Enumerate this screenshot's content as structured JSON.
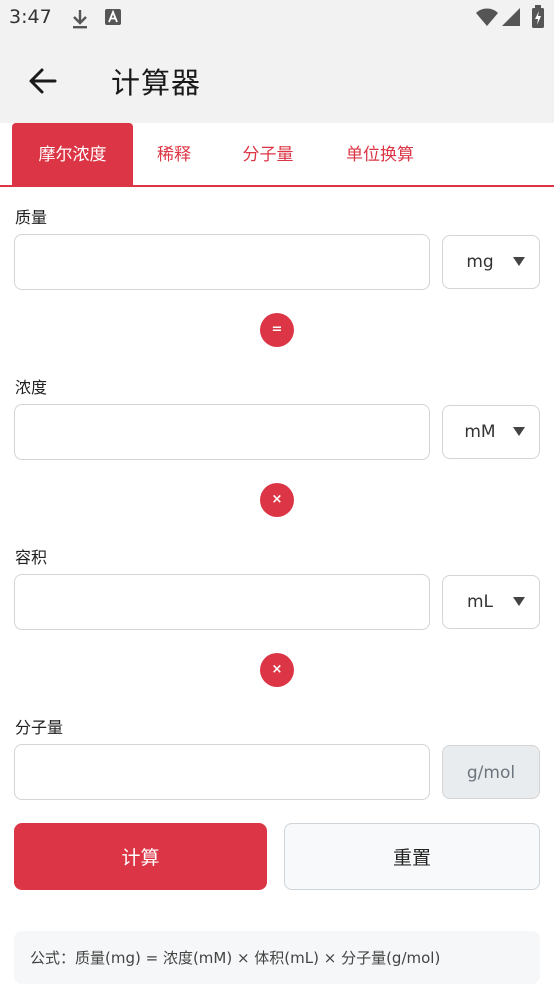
{
  "status": {
    "time": "3:47"
  },
  "header": {
    "title": "计算器"
  },
  "tabs": [
    {
      "label": "摩尔浓度",
      "active": true
    },
    {
      "label": "稀释",
      "active": false
    },
    {
      "label": "分子量",
      "active": false
    },
    {
      "label": "单位换算",
      "active": false
    }
  ],
  "fields": {
    "mass": {
      "label": "质量",
      "value": "",
      "placeholder": "",
      "unit": "mg"
    },
    "concentration": {
      "label": "浓度",
      "value": "",
      "placeholder": "",
      "unit": "mM"
    },
    "volume": {
      "label": "容积",
      "value": "",
      "placeholder": "",
      "unit": "mL"
    },
    "molecular_weight": {
      "label": "分子量",
      "value": "",
      "placeholder": "",
      "unit": "g/mol"
    }
  },
  "operators": {
    "equals": "=",
    "times1": "×",
    "times2": "×"
  },
  "buttons": {
    "calculate": "计算",
    "reset": "重置"
  },
  "formula": "公式：质量(mg) = 浓度(mM) × 体积(mL) × 分子量(g/mol)",
  "colors": {
    "accent": "#dc3545",
    "appbar_bg": "#f2f2f2",
    "disabled_bg": "#e9ecef"
  },
  "icons": [
    "download-icon",
    "text-a-icon",
    "wifi-icon",
    "signal-icon",
    "battery-icon",
    "back-arrow-icon",
    "caret-down-icon"
  ]
}
